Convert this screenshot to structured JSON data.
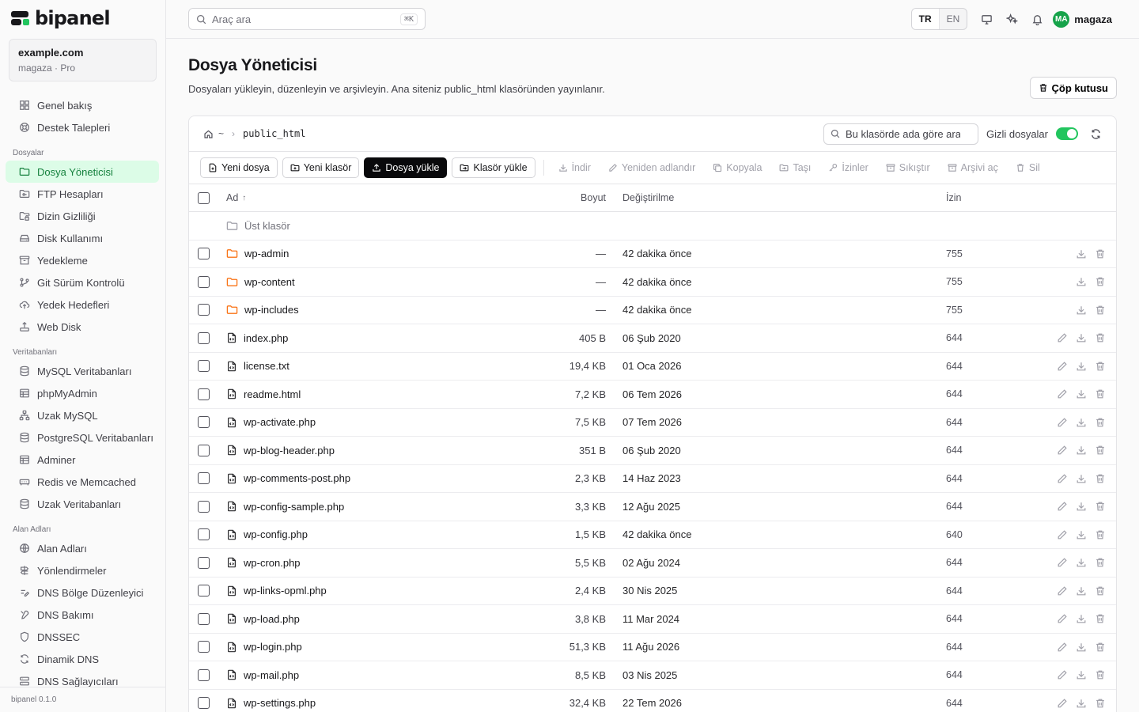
{
  "brand": {
    "name": "bipanel",
    "version": "bipanel 0.1.0"
  },
  "account": {
    "domain": "example.com",
    "sub": "magaza · Pro"
  },
  "nav": {
    "top": [
      {
        "label": "Genel bakış",
        "icon": "dashboard-icon"
      },
      {
        "label": "Destek Talepleri",
        "icon": "lifebuoy-icon"
      }
    ],
    "files_section": "Dosyalar",
    "files": [
      {
        "label": "Dosya Yöneticisi",
        "icon": "folder-icon",
        "active": true
      },
      {
        "label": "FTP Hesapları",
        "icon": "folder-key-icon"
      },
      {
        "label": "Dizin Gizliliği",
        "icon": "folder-lock-icon"
      },
      {
        "label": "Disk Kullanımı",
        "icon": "hard-drive-icon"
      },
      {
        "label": "Yedekleme",
        "icon": "archive-icon"
      },
      {
        "label": "Git Sürüm Kontrolü",
        "icon": "git-branch-icon"
      },
      {
        "label": "Yedek Hedefleri",
        "icon": "cloud-upload-icon"
      },
      {
        "label": "Web Disk",
        "icon": "upload-disk-icon"
      }
    ],
    "db_section": "Veritabanları",
    "db": [
      {
        "label": "MySQL Veritabanları",
        "icon": "database-icon"
      },
      {
        "label": "phpMyAdmin",
        "icon": "table-icon"
      },
      {
        "label": "Uzak MySQL",
        "icon": "network-icon"
      },
      {
        "label": "PostgreSQL Veritabanları",
        "icon": "database-icon"
      },
      {
        "label": "Adminer",
        "icon": "table-icon"
      },
      {
        "label": "Redis ve Memcached",
        "icon": "memory-icon"
      },
      {
        "label": "Uzak Veritabanları",
        "icon": "database-icon"
      }
    ],
    "domains_section": "Alan Adları",
    "domains": [
      {
        "label": "Alan Adları",
        "icon": "globe-icon"
      },
      {
        "label": "Yönlendirmeler",
        "icon": "signpost-icon"
      },
      {
        "label": "DNS Bölge Düzenleyici",
        "icon": "dns-edit-icon"
      },
      {
        "label": "DNS Bakımı",
        "icon": "dns-tools-icon"
      },
      {
        "label": "DNSSEC",
        "icon": "dnssec-icon"
      },
      {
        "label": "Dinamik DNS",
        "icon": "dynamic-dns-icon"
      },
      {
        "label": "DNS Sağlayıcıları",
        "icon": "dns-provider-icon"
      }
    ]
  },
  "topbar": {
    "search_placeholder": "Araç ara",
    "shortcut": "⌘K",
    "lang_tr": "TR",
    "lang_en": "EN",
    "user_initials": "MA",
    "user_name": "magaza"
  },
  "page": {
    "title": "Dosya Yöneticisi",
    "description": "Dosyaları yükleyin, düzenleyin ve arşivleyin. Ana siteniz public_html klasöründen yayınlanır.",
    "trash_label": "Çöp kutusu"
  },
  "browser": {
    "home_tilde": "~",
    "path": "public_html",
    "folder_search_placeholder": "Bu klasörde ada göre ara",
    "hidden_files_label": "Gizli dosyalar",
    "hidden_files_on": true
  },
  "toolbar": {
    "new_file": "Yeni dosya",
    "new_folder": "Yeni klasör",
    "upload_file": "Dosya yükle",
    "upload_folder": "Klasör yükle",
    "download": "İndir",
    "rename": "Yeniden adlandır",
    "copy": "Kopyala",
    "move": "Taşı",
    "permissions": "İzinler",
    "compress": "Sıkıştır",
    "extract": "Arşivi aç",
    "delete": "Sil"
  },
  "table": {
    "headers": {
      "name": "Ad",
      "sort_arrow": "↑",
      "size": "Boyut",
      "modified": "Değiştirilme",
      "perm": "İzin"
    },
    "parent_label": "Üst klasör",
    "rows": [
      {
        "name": "wp-admin",
        "type": "folder",
        "size": "—",
        "modified": "42 dakika önce",
        "perm": "755"
      },
      {
        "name": "wp-content",
        "type": "folder",
        "size": "—",
        "modified": "42 dakika önce",
        "perm": "755"
      },
      {
        "name": "wp-includes",
        "type": "folder",
        "size": "—",
        "modified": "42 dakika önce",
        "perm": "755"
      },
      {
        "name": "index.php",
        "type": "file",
        "size": "405 B",
        "modified": "06 Şub 2020",
        "perm": "644"
      },
      {
        "name": "license.txt",
        "type": "file",
        "size": "19,4 KB",
        "modified": "01 Oca 2026",
        "perm": "644"
      },
      {
        "name": "readme.html",
        "type": "file",
        "size": "7,2 KB",
        "modified": "06 Tem 2026",
        "perm": "644"
      },
      {
        "name": "wp-activate.php",
        "type": "file",
        "size": "7,5 KB",
        "modified": "07 Tem 2026",
        "perm": "644"
      },
      {
        "name": "wp-blog-header.php",
        "type": "file",
        "size": "351 B",
        "modified": "06 Şub 2020",
        "perm": "644"
      },
      {
        "name": "wp-comments-post.php",
        "type": "file",
        "size": "2,3 KB",
        "modified": "14 Haz 2023",
        "perm": "644"
      },
      {
        "name": "wp-config-sample.php",
        "type": "file",
        "size": "3,3 KB",
        "modified": "12 Ağu 2025",
        "perm": "644"
      },
      {
        "name": "wp-config.php",
        "type": "file",
        "size": "1,5 KB",
        "modified": "42 dakika önce",
        "perm": "640"
      },
      {
        "name": "wp-cron.php",
        "type": "file",
        "size": "5,5 KB",
        "modified": "02 Ağu 2024",
        "perm": "644"
      },
      {
        "name": "wp-links-opml.php",
        "type": "file",
        "size": "2,4 KB",
        "modified": "30 Nis 2025",
        "perm": "644"
      },
      {
        "name": "wp-load.php",
        "type": "file",
        "size": "3,8 KB",
        "modified": "11 Mar 2024",
        "perm": "644"
      },
      {
        "name": "wp-login.php",
        "type": "file",
        "size": "51,3 KB",
        "modified": "11 Ağu 2026",
        "perm": "644"
      },
      {
        "name": "wp-mail.php",
        "type": "file",
        "size": "8,5 KB",
        "modified": "03 Nis 2025",
        "perm": "644"
      },
      {
        "name": "wp-settings.php",
        "type": "file",
        "size": "32,4 KB",
        "modified": "22 Tem 2026",
        "perm": "644"
      }
    ]
  },
  "colors": {
    "accent": "#22c55e",
    "active_bg": "#dcfce7",
    "active_text": "#15803d",
    "folder": "#f97316"
  }
}
